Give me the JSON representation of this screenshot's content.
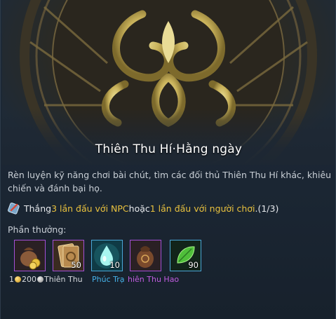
{
  "tooltip": {
    "title": "Thiên Thu Hí·Hằng ngày",
    "description": "Rèn luyện kỹ năng chơi bài chút, tìm các đối thủ Thiên Thu Hí khác, khiêu chiến và đánh bại họ.",
    "quest": {
      "prefix": "Thắng ",
      "highlight1": "3 lần đấu với NPC",
      "middle": " hoặc ",
      "highlight2": "1 lần đấu với người chơi",
      "suffix": ".(1/3)"
    },
    "rewards_label": "Phần thưởng:",
    "rewards": [
      {
        "icon": "coin-bag-icon",
        "count": "",
        "border": "#a44fd6"
      },
      {
        "icon": "card-pack-icon",
        "count": "50",
        "border": "#a44fd6"
      },
      {
        "icon": "water-drop-icon",
        "count": "10",
        "border": "#4aa7d8"
      },
      {
        "icon": "treasure-pouch-icon",
        "count": "",
        "border": "#a44fd6"
      },
      {
        "icon": "jade-leaf-icon",
        "count": "90",
        "border": "#4aa7d8"
      }
    ],
    "captions": {
      "c1": "1",
      "c2": "200",
      "c3": "Thiên Thu",
      "c4": "Phúc Trạ",
      "c5": "hiên Thu Hao"
    },
    "colors": {
      "highlight": "#e8c13e",
      "blue_rarity": "#45b1e8",
      "purple_rarity": "#c05ce0"
    }
  }
}
